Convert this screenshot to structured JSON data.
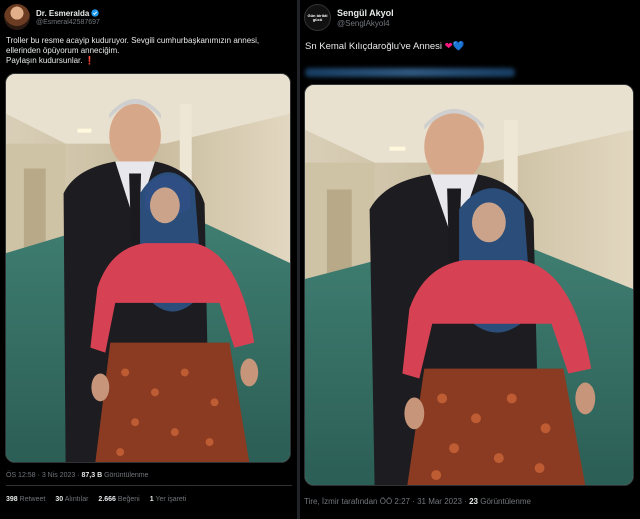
{
  "left_tweet": {
    "display_name": "Dr. Esmeralda",
    "handle": "@Esmeral42587697",
    "text_lines": [
      "Troller bu resme acayip kuduruyor. Sevgili cumhurbaşkanımızın annesi,",
      "ellerinden öpüyorum anneciğim.",
      "Paylaşın kudursunlar. "
    ],
    "text_emoji": "❗",
    "time": "ÖS 12:58",
    "date": "3 Nis 2023",
    "views_count": "87,3 B",
    "views_label": "Görüntülenme",
    "stats": [
      {
        "count": "398",
        "label": "Retweet"
      },
      {
        "count": "30",
        "label": "Alıntılar"
      },
      {
        "count": "2.666",
        "label": "Beğeni"
      },
      {
        "count": "1",
        "label": "Yer işareti"
      }
    ]
  },
  "right_tweet": {
    "display_name": "Sengül Akyol",
    "handle": "@SenglAkyol4",
    "avatar_text": "Gün birikti gücü",
    "text": "Sn Kemal Kılıçdaroğlu've Annesi ",
    "emoji_red_heart": "❤",
    "emoji_blue_heart": "💙",
    "location_time": "Tire, İzmir tarafından ÖÖ 2:27 · 31 Mar 2023 · ",
    "views_count": "23",
    "views_label": "Görüntülenme"
  },
  "colors": {
    "background": "#000000",
    "text_primary": "#e7e9ea",
    "text_secondary": "#71767b",
    "verified": "#1d9bf0",
    "border": "#2f3336"
  },
  "icons": [
    "verified-badge-icon",
    "red-heart-icon",
    "blue-heart-icon",
    "exclamation-icon"
  ]
}
